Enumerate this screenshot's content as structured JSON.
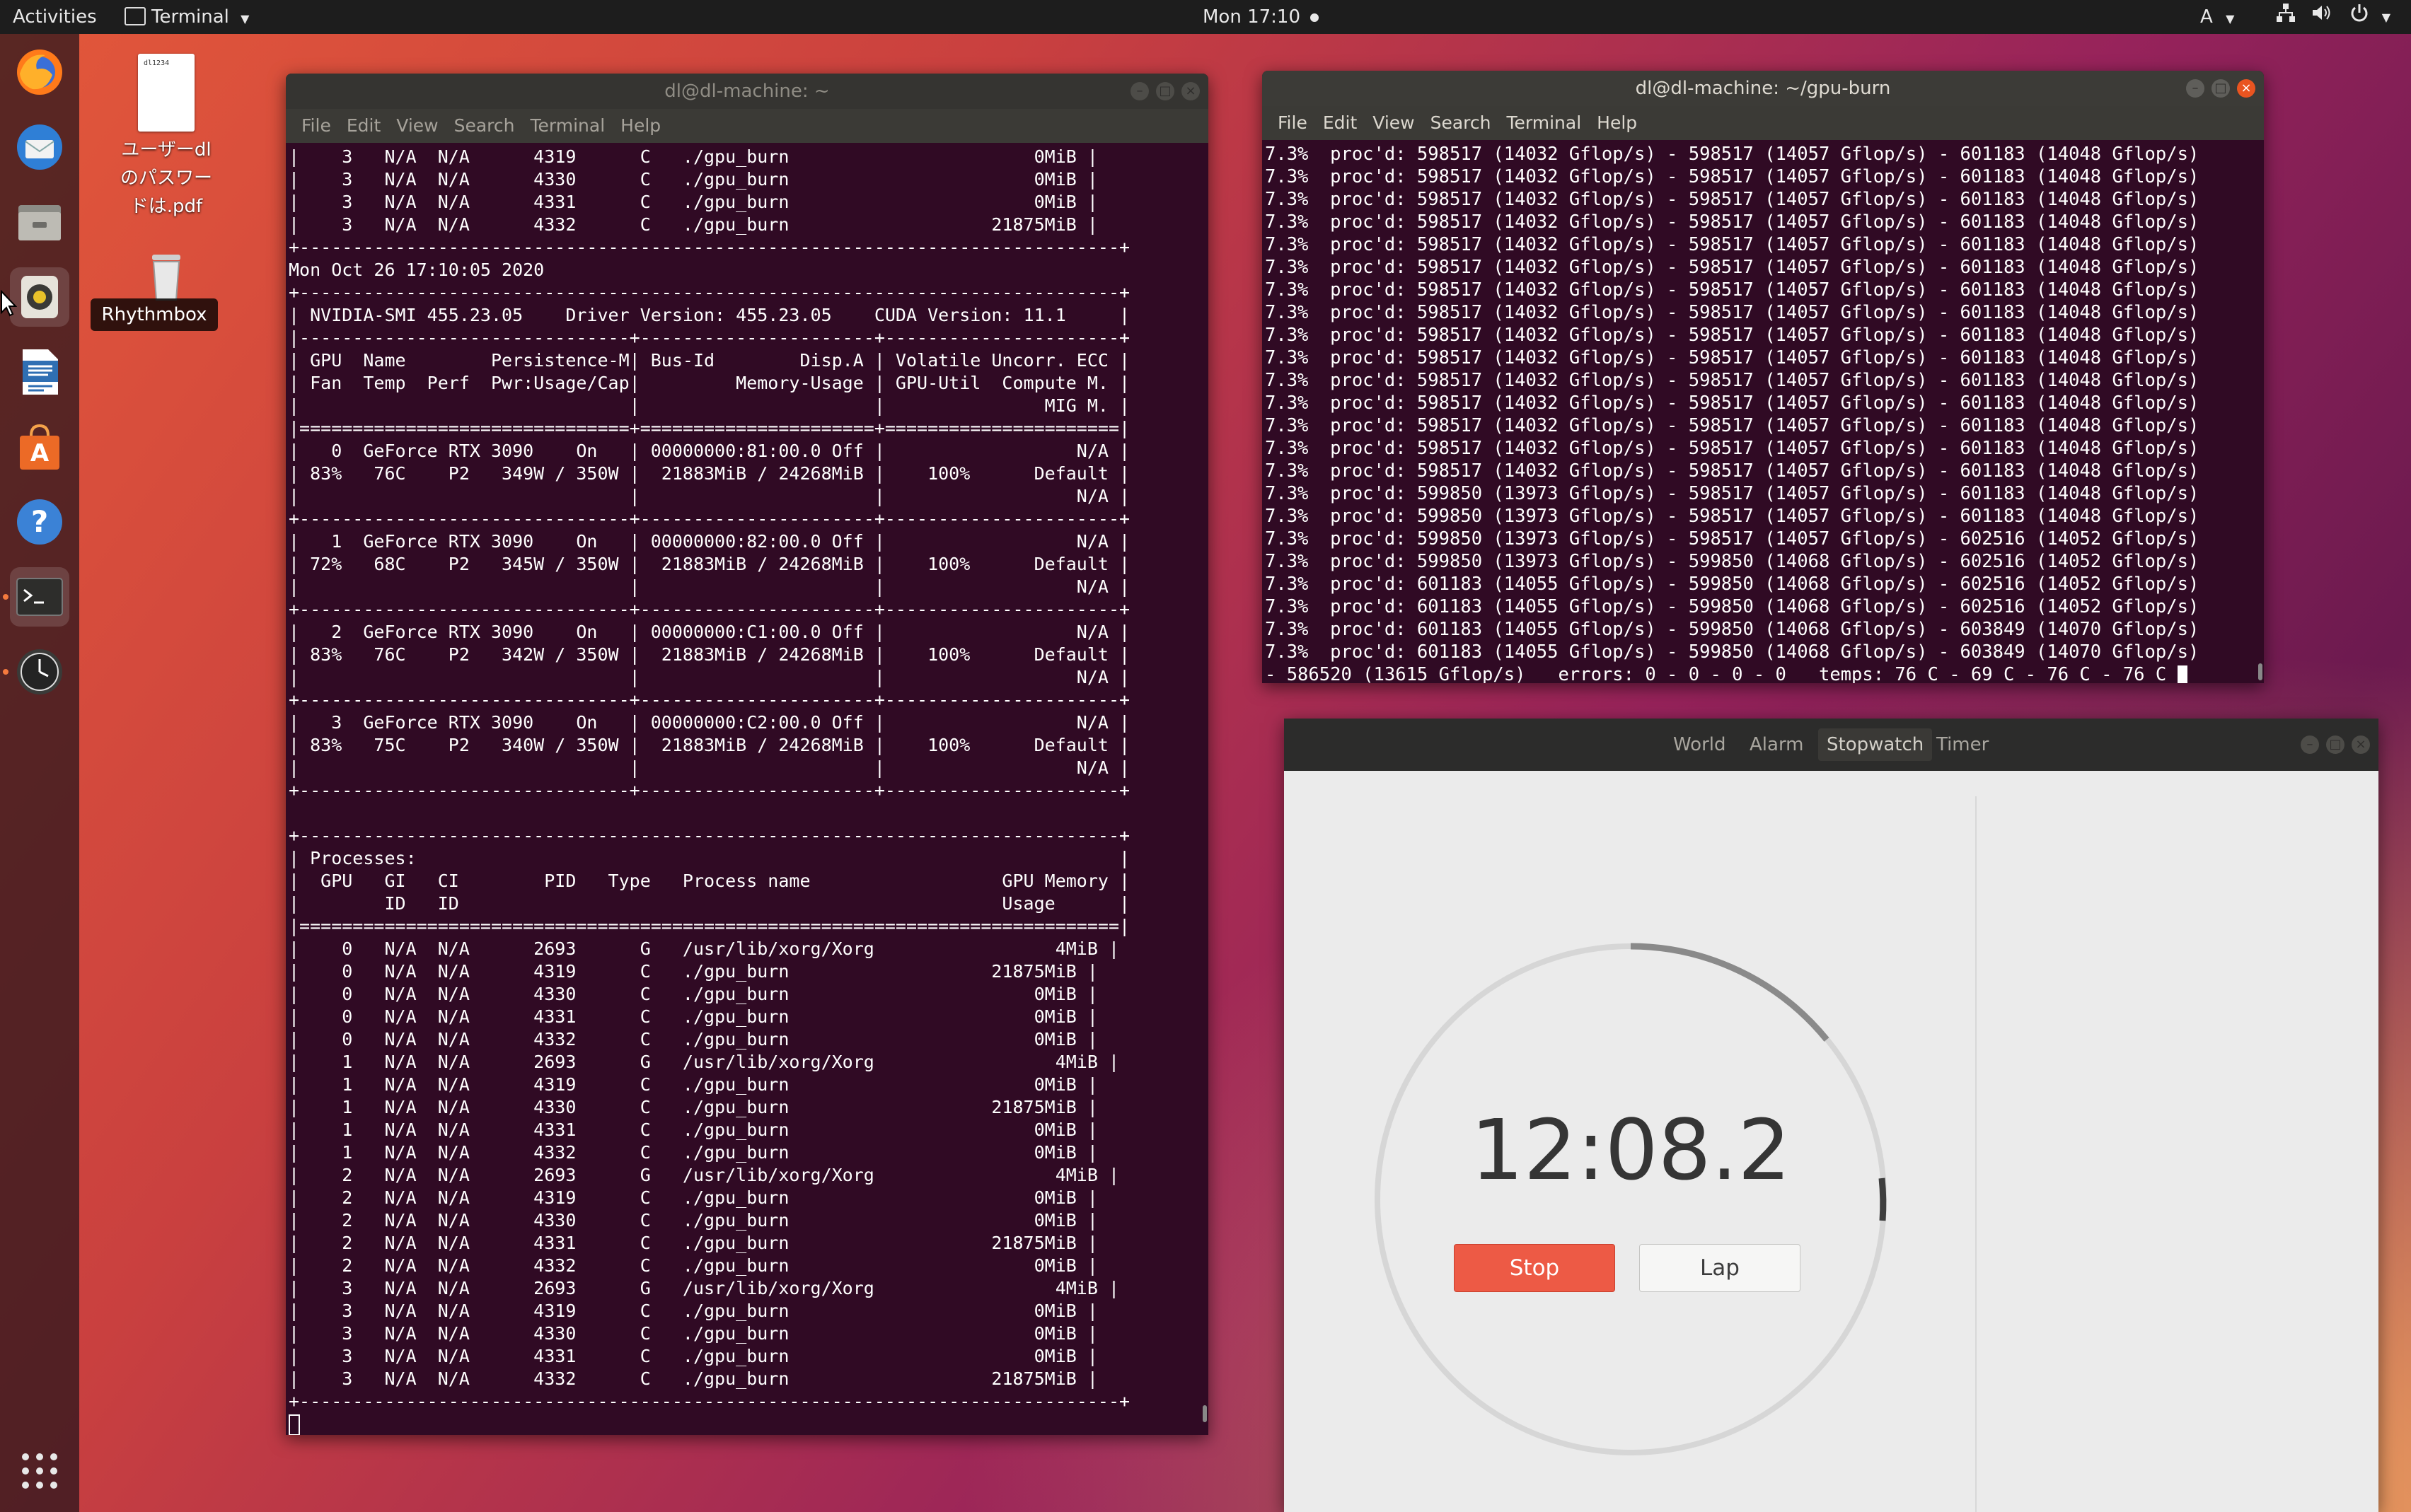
{
  "topbar": {
    "activities": "Activities",
    "app_menu": "Terminal",
    "clock": "Mon 17:10",
    "input_source": "A"
  },
  "desktop": {
    "file_name": "ユーザーdlのパスワードは.pdf",
    "file_name_lines": [
      "ユーザーdl",
      "のパスワー",
      "ドは.pdf"
    ],
    "file_thumb_text": "dl1234",
    "dock_tooltip": "Rhythmbox"
  },
  "term1": {
    "title": "dl@dl-machine: ~",
    "menu": [
      "File",
      "Edit",
      "View",
      "Search",
      "Terminal",
      "Help"
    ],
    "lines": [
      "|    3   N/A  N/A      4319      C   ./gpu_burn                       0MiB |",
      "|    3   N/A  N/A      4330      C   ./gpu_burn                       0MiB |",
      "|    3   N/A  N/A      4331      C   ./gpu_burn                       0MiB |",
      "|    3   N/A  N/A      4332      C   ./gpu_burn                   21875MiB |",
      "+-----------------------------------------------------------------------------+",
      "Mon Oct 26 17:10:05 2020",
      "+-----------------------------------------------------------------------------+",
      "| NVIDIA-SMI 455.23.05    Driver Version: 455.23.05    CUDA Version: 11.1     |",
      "|-------------------------------+----------------------+----------------------+",
      "| GPU  Name        Persistence-M| Bus-Id        Disp.A | Volatile Uncorr. ECC |",
      "| Fan  Temp  Perf  Pwr:Usage/Cap|         Memory-Usage | GPU-Util  Compute M. |",
      "|                               |                      |               MIG M. |",
      "|===============================+======================+======================|",
      "|   0  GeForce RTX 3090    On   | 00000000:81:00.0 Off |                  N/A |",
      "| 83%   76C    P2   349W / 350W |  21883MiB / 24268MiB |    100%      Default |",
      "|                               |                      |                  N/A |",
      "+-------------------------------+----------------------+----------------------+",
      "|   1  GeForce RTX 3090    On   | 00000000:82:00.0 Off |                  N/A |",
      "| 72%   68C    P2   345W / 350W |  21883MiB / 24268MiB |    100%      Default |",
      "|                               |                      |                  N/A |",
      "+-------------------------------+----------------------+----------------------+",
      "|   2  GeForce RTX 3090    On   | 00000000:C1:00.0 Off |                  N/A |",
      "| 83%   76C    P2   342W / 350W |  21883MiB / 24268MiB |    100%      Default |",
      "|                               |                      |                  N/A |",
      "+-------------------------------+----------------------+----------------------+",
      "|   3  GeForce RTX 3090    On   | 00000000:C2:00.0 Off |                  N/A |",
      "| 83%   75C    P2   340W / 350W |  21883MiB / 24268MiB |    100%      Default |",
      "|                               |                      |                  N/A |",
      "+-------------------------------+----------------------+----------------------+",
      "",
      "+-----------------------------------------------------------------------------+",
      "| Processes:                                                                  |",
      "|  GPU   GI   CI        PID   Type   Process name                  GPU Memory |",
      "|        ID   ID                                                   Usage      |",
      "|=============================================================================|",
      "|    0   N/A  N/A      2693      G   /usr/lib/xorg/Xorg                 4MiB |",
      "|    0   N/A  N/A      4319      C   ./gpu_burn                   21875MiB |",
      "|    0   N/A  N/A      4330      C   ./gpu_burn                       0MiB |",
      "|    0   N/A  N/A      4331      C   ./gpu_burn                       0MiB |",
      "|    0   N/A  N/A      4332      C   ./gpu_burn                       0MiB |",
      "|    1   N/A  N/A      2693      G   /usr/lib/xorg/Xorg                 4MiB |",
      "|    1   N/A  N/A      4319      C   ./gpu_burn                       0MiB |",
      "|    1   N/A  N/A      4330      C   ./gpu_burn                   21875MiB |",
      "|    1   N/A  N/A      4331      C   ./gpu_burn                       0MiB |",
      "|    1   N/A  N/A      4332      C   ./gpu_burn                       0MiB |",
      "|    2   N/A  N/A      2693      G   /usr/lib/xorg/Xorg                 4MiB |",
      "|    2   N/A  N/A      4319      C   ./gpu_burn                       0MiB |",
      "|    2   N/A  N/A      4330      C   ./gpu_burn                       0MiB |",
      "|    2   N/A  N/A      4331      C   ./gpu_burn                   21875MiB |",
      "|    2   N/A  N/A      4332      C   ./gpu_burn                       0MiB |",
      "|    3   N/A  N/A      2693      G   /usr/lib/xorg/Xorg                 4MiB |",
      "|    3   N/A  N/A      4319      C   ./gpu_burn                       0MiB |",
      "|    3   N/A  N/A      4330      C   ./gpu_burn                       0MiB |",
      "|    3   N/A  N/A      4331      C   ./gpu_burn                       0MiB |",
      "|    3   N/A  N/A      4332      C   ./gpu_burn                   21875MiB |",
      "+-----------------------------------------------------------------------------+"
    ]
  },
  "term2": {
    "title": "dl@dl-machine: ~/gpu-burn",
    "menu": [
      "File",
      "Edit",
      "View",
      "Search",
      "Terminal",
      "Help"
    ],
    "lines": [
      "7.3%  proc'd: 598517 (14032 Gflop/s) - 598517 (14057 Gflop/s) - 601183 (14048 Gflop/s)",
      "7.3%  proc'd: 598517 (14032 Gflop/s) - 598517 (14057 Gflop/s) - 601183 (14048 Gflop/s)",
      "7.3%  proc'd: 598517 (14032 Gflop/s) - 598517 (14057 Gflop/s) - 601183 (14048 Gflop/s)",
      "7.3%  proc'd: 598517 (14032 Gflop/s) - 598517 (14057 Gflop/s) - 601183 (14048 Gflop/s)",
      "7.3%  proc'd: 598517 (14032 Gflop/s) - 598517 (14057 Gflop/s) - 601183 (14048 Gflop/s)",
      "7.3%  proc'd: 598517 (14032 Gflop/s) - 598517 (14057 Gflop/s) - 601183 (14048 Gflop/s)",
      "7.3%  proc'd: 598517 (14032 Gflop/s) - 598517 (14057 Gflop/s) - 601183 (14048 Gflop/s)",
      "7.3%  proc'd: 598517 (14032 Gflop/s) - 598517 (14057 Gflop/s) - 601183 (14048 Gflop/s)",
      "7.3%  proc'd: 598517 (14032 Gflop/s) - 598517 (14057 Gflop/s) - 601183 (14048 Gflop/s)",
      "7.3%  proc'd: 598517 (14032 Gflop/s) - 598517 (14057 Gflop/s) - 601183 (14048 Gflop/s)",
      "7.3%  proc'd: 598517 (14032 Gflop/s) - 598517 (14057 Gflop/s) - 601183 (14048 Gflop/s)",
      "7.3%  proc'd: 598517 (14032 Gflop/s) - 598517 (14057 Gflop/s) - 601183 (14048 Gflop/s)",
      "7.3%  proc'd: 598517 (14032 Gflop/s) - 598517 (14057 Gflop/s) - 601183 (14048 Gflop/s)",
      "7.3%  proc'd: 598517 (14032 Gflop/s) - 598517 (14057 Gflop/s) - 601183 (14048 Gflop/s)",
      "7.3%  proc'd: 598517 (14032 Gflop/s) - 598517 (14057 Gflop/s) - 601183 (14048 Gflop/s)",
      "7.3%  proc'd: 599850 (13973 Gflop/s) - 598517 (14057 Gflop/s) - 601183 (14048 Gflop/s)",
      "7.3%  proc'd: 599850 (13973 Gflop/s) - 598517 (14057 Gflop/s) - 601183 (14048 Gflop/s)",
      "7.3%  proc'd: 599850 (13973 Gflop/s) - 598517 (14057 Gflop/s) - 602516 (14052 Gflop/s)",
      "7.3%  proc'd: 599850 (13973 Gflop/s) - 599850 (14068 Gflop/s) - 602516 (14052 Gflop/s)",
      "7.3%  proc'd: 601183 (14055 Gflop/s) - 599850 (14068 Gflop/s) - 602516 (14052 Gflop/s)",
      "7.3%  proc'd: 601183 (14055 Gflop/s) - 599850 (14068 Gflop/s) - 602516 (14052 Gflop/s)",
      "7.3%  proc'd: 601183 (14055 Gflop/s) - 599850 (14068 Gflop/s) - 603849 (14070 Gflop/s)",
      "7.3%  proc'd: 601183 (14055 Gflop/s) - 599850 (14068 Gflop/s) - 603849 (14070 Gflop/s)"
    ],
    "last_line": "- 586520 (13615 Gflop/s)   errors: 0 - 0 - 0 - 0   temps: 76 C - 69 C - 76 C - 76 C "
  },
  "clocks": {
    "tabs": [
      "World",
      "Alarm",
      "Stopwatch",
      "Timer"
    ],
    "selected_tab": "Stopwatch",
    "time": "12:08.2",
    "stop_label": "Stop",
    "lap_label": "Lap"
  },
  "colors": {
    "terminal_bg": "#300a24",
    "accent_orange": "#e95420",
    "stop_red": "#ed5a45"
  }
}
